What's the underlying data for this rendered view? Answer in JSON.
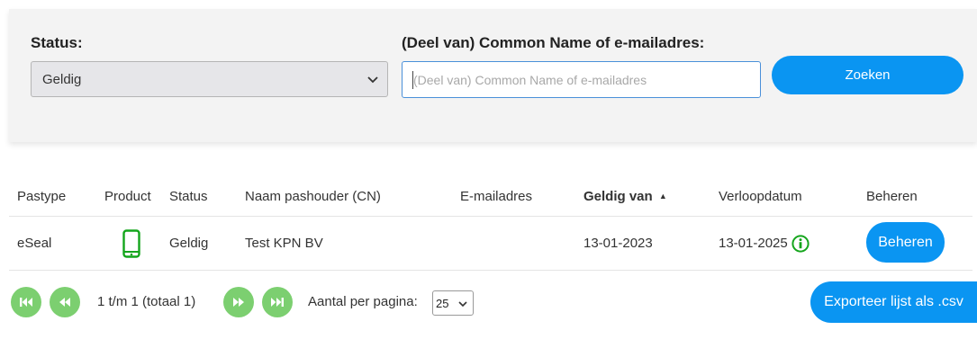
{
  "filters": {
    "status_label": "Status:",
    "status_value": "Geldig",
    "cn_label": "(Deel van) Common Name of e-mailadres:",
    "cn_placeholder": "(Deel van) Common Name of e-mailadres",
    "cn_value": "",
    "search_button": "Zoeken"
  },
  "table": {
    "columns": [
      "Pastype",
      "Product",
      "Status",
      "Naam pashouder (CN)",
      "E-mailadres",
      "Geldig van",
      "Verloopdatum",
      "Beheren"
    ],
    "sorted_column": "Geldig van",
    "sort_indicator": "▲",
    "rows": [
      {
        "pastype": "eSeal",
        "product_icon": "mobile-phone-icon",
        "status": "Geldig",
        "naam": "Test KPN BV",
        "email": "",
        "geldig_van": "13-01-2023",
        "verloopdatum": "13-01-2025",
        "action": "Beheren"
      }
    ]
  },
  "pagination": {
    "range_text": "1 t/m 1 (totaal 1)",
    "per_page_label": "Aantal per pagina:",
    "per_page_value": "25",
    "export_button": "Exporteer lijst als .csv"
  },
  "colors": {
    "primary": "#0a95f2",
    "pager_green": "#7ccf70",
    "icon_green": "#14a51c",
    "panel_bg": "#f3f3f3"
  }
}
